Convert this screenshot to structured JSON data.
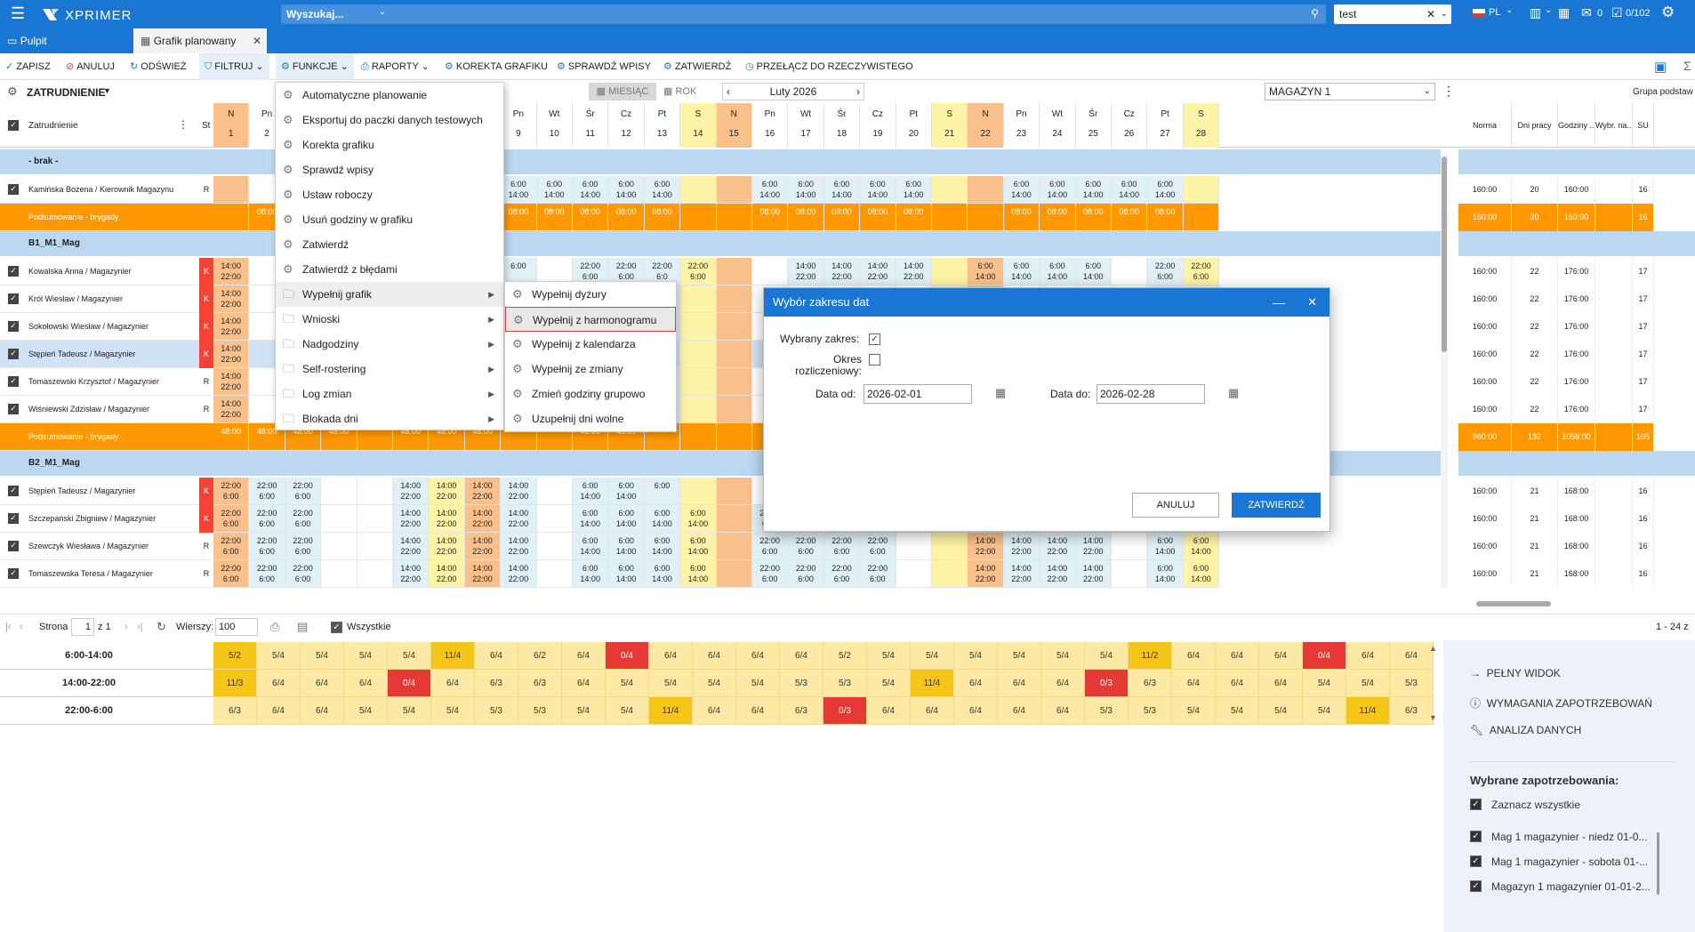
{
  "app": {
    "brand": "XPRIMER",
    "search_placeholder": "Wyszukaj...",
    "filter_value": "test",
    "lang": "PL",
    "counter_a": "0",
    "counter_b": "0/102"
  },
  "tabs": [
    {
      "label": "Pulpit"
    },
    {
      "label": "Grafik planowany"
    }
  ],
  "toolbar": {
    "save": "ZAPISZ",
    "cancel": "ANULUJ",
    "refresh": "ODŚWIEŻ",
    "filter": "FILTRUJ",
    "functions": "FUNKCJE",
    "reports": "RAPORTY",
    "correction": "KOREKTA GRAFIKU",
    "check": "SPRAWDŹ WPISY",
    "approve": "ZATWIERDŹ",
    "switch": "PRZEŁĄCZ DO RZECZYWISTEGO"
  },
  "subbar": {
    "group": "ZATRUDNIENIE",
    "month": "MIESIĄC",
    "year": "ROK",
    "period": "Luty 2026",
    "warehouse": "MAGAZYN 1",
    "group_label": "Grupa podstaw"
  },
  "grid": {
    "emp_header": "Zatrudnienie",
    "st_header": "St",
    "days": [
      {
        "d": "N",
        "n": "1"
      },
      {
        "d": "Pn",
        "n": "2"
      },
      {
        "d": "Wt",
        "n": "3"
      },
      {
        "d": "Śr",
        "n": "4"
      },
      {
        "d": "Cz",
        "n": "5"
      },
      {
        "d": "Pt",
        "n": "6"
      },
      {
        "d": "S",
        "n": "7"
      },
      {
        "d": "N",
        "n": "8"
      },
      {
        "d": "Pn",
        "n": "9"
      },
      {
        "d": "Wt",
        "n": "10"
      },
      {
        "d": "Śr",
        "n": "11"
      },
      {
        "d": "Cz",
        "n": "12"
      },
      {
        "d": "Pt",
        "n": "13"
      },
      {
        "d": "S",
        "n": "14"
      },
      {
        "d": "N",
        "n": "15"
      },
      {
        "d": "Pn",
        "n": "16"
      },
      {
        "d": "Wt",
        "n": "17"
      },
      {
        "d": "Śr",
        "n": "18"
      },
      {
        "d": "Cz",
        "n": "19"
      },
      {
        "d": "Pt",
        "n": "20"
      },
      {
        "d": "S",
        "n": "21"
      },
      {
        "d": "N",
        "n": "22"
      },
      {
        "d": "Pn",
        "n": "23"
      },
      {
        "d": "Wt",
        "n": "24"
      },
      {
        "d": "Śr",
        "n": "25"
      },
      {
        "d": "Cz",
        "n": "26"
      },
      {
        "d": "Pt",
        "n": "27"
      },
      {
        "d": "S",
        "n": "28"
      }
    ],
    "right_headers": [
      "Norma",
      "Dni pracy",
      "Godziny ...",
      "Wybr. na...",
      "SU"
    ],
    "rows": [
      {
        "kind": "group",
        "label": "- brak -"
      },
      {
        "kind": "emp",
        "name": "Kamińska Bożena / Kierownik Magazynu",
        "st": "R",
        "vals": [
          "",
          "",
          "",
          "",
          "",
          "",
          "",
          "",
          "6:00\n14:00",
          "6:00\n14:00",
          "6:00\n14:00",
          "6:00\n14:00",
          "6:00\n14:00",
          "",
          "",
          "6:00\n14:00",
          "6:00\n14:00",
          "6:00\n14:00",
          "6:00\n14:00",
          "6:00\n14:00",
          "",
          "",
          "6:00\n14:00",
          "6:00\n14:00",
          "6:00\n14:00",
          "6:00\n14:00",
          "6:00\n14:00",
          ""
        ],
        "right": [
          "160:00",
          "20",
          "160:00",
          "",
          "16"
        ]
      },
      {
        "kind": "sum",
        "name": "Podsumowanie - brygady",
        "vals": [
          "",
          "08:00",
          "",
          "",
          "",
          "",
          "",
          "",
          "08:00",
          "08:00",
          "08:00",
          "08:00",
          "08:00",
          "",
          "",
          "08:00",
          "08:00",
          "08:00",
          "08:00",
          "08:00",
          "",
          "",
          "08:00",
          "08:00",
          "08:00",
          "08:00",
          "08:00",
          ""
        ],
        "right": [
          "160:00",
          "20",
          "160:00",
          "",
          "16"
        ]
      },
      {
        "kind": "group",
        "label": "B1_M1_Mag"
      },
      {
        "kind": "emp",
        "name": "Kowalska Anna / Magazynier",
        "st": "K",
        "vals": [
          "14:00\n22:00",
          "",
          "",
          "",
          "",
          "",
          "",
          "6:00",
          "6:00",
          "",
          "22:00\n6:00",
          "22:00\n6:00",
          "22:00\n6:0",
          "22:00\n6:00",
          "",
          "",
          "14:00\n22:00",
          "14:00\n22:00",
          "14:00\n22:00",
          "14:00\n22:00",
          "",
          "6:00\n14:00",
          "6:00\n14:00",
          "6:00\n14:00",
          "6:00\n14:00",
          "",
          "22:00\n6:00",
          "22:00\n6:00"
        ],
        "right": [
          "160:00",
          "22",
          "176:00",
          "",
          "17"
        ]
      },
      {
        "kind": "emp",
        "name": "Król Wiesław / Magazynier",
        "st": "K",
        "vals": [
          "14:00\n22:00",
          "",
          "",
          "",
          "",
          "",
          "",
          "",
          "",
          "",
          "",
          "22:00\n6:00",
          "22:\n6:0",
          "",
          "",
          "",
          "",
          "",
          "",
          "",
          "",
          "",
          "",
          "",
          "",
          "",
          "22:00\n6:00",
          "22:00\n6:00"
        ],
        "right": [
          "160:00",
          "22",
          "176:00",
          "",
          "17"
        ]
      },
      {
        "kind": "emp",
        "name": "Sokołowski Wiesław / Magazynier",
        "st": "K",
        "vals": [
          "14:00\n22:00",
          "",
          "",
          "",
          "",
          "",
          "",
          "",
          "",
          "",
          "",
          "22:00\n6:00",
          "22:\n6:0",
          "",
          "",
          "",
          "",
          "",
          "",
          "",
          "",
          "",
          "",
          "",
          "",
          "",
          "22:00\n6:00",
          "22:00\n6:00"
        ],
        "right": [
          "160:00",
          "22",
          "176:00",
          "",
          "17"
        ]
      },
      {
        "kind": "emp",
        "name": "Stępień Tadeusz / Magazynier",
        "st": "K",
        "sel": true,
        "vals": [
          "14:00\n22:00",
          "",
          "",
          "",
          "",
          "",
          "",
          "",
          "",
          "",
          "",
          "22:00\n6:00",
          "22:\n6:0",
          "",
          "",
          "",
          "",
          "",
          "",
          "",
          "",
          "",
          "",
          "",
          "",
          "",
          "22:00\n6:00",
          "22:00\n6:00"
        ],
        "right": [
          "160:00",
          "22",
          "176:00",
          "",
          "17"
        ]
      },
      {
        "kind": "emp",
        "name": "Tomaszewski Krzysztof / Magazynier",
        "st": "R",
        "vals": [
          "14:00\n22:00",
          "",
          "",
          "",
          "",
          "",
          "",
          "",
          "",
          "",
          "",
          "22:00\n6:00",
          "22:\n6:0",
          "",
          "",
          "",
          "",
          "",
          "",
          "",
          "",
          "",
          "",
          "",
          "",
          "",
          "22:00\n6:00",
          "22:00\n6:00"
        ],
        "right": [
          "160:00",
          "22",
          "176:00",
          "",
          "17"
        ]
      },
      {
        "kind": "emp",
        "name": "Wiśniewski Zdzisław / Magazynier",
        "st": "R",
        "vals": [
          "14:00\n22:00",
          "",
          "",
          "",
          "",
          "",
          "",
          "",
          "",
          "",
          "",
          "22:00\n6:00",
          "22:\n6:0",
          "",
          "",
          "",
          "",
          "",
          "",
          "",
          "",
          "",
          "",
          "",
          "",
          "",
          "22:00\n6:00",
          "22:00\n6:00"
        ],
        "right": [
          "160:00",
          "22",
          "176:00",
          "",
          "17"
        ]
      },
      {
        "kind": "sum",
        "name": "Podsumowanie - brygady",
        "vals": [
          "48:00",
          "48:00",
          "48:00",
          "48:00",
          "",
          "48:00",
          "48:00",
          "48:00",
          "",
          "",
          "48:00",
          "48:00",
          "",
          "",
          "",
          "",
          "",
          "",
          "",
          "",
          "",
          "",
          "",
          "",
          "",
          "",
          "48:00",
          "48:00"
        ],
        "right": [
          "960:00",
          "132",
          "1056:00",
          "",
          "105"
        ]
      },
      {
        "kind": "group",
        "label": "B2_M1_Mag"
      },
      {
        "kind": "emp",
        "name": "Stępień Tadeusz / Magazynier",
        "st": "K",
        "vals": [
          "22:00\n6:00",
          "22:00\n6:00",
          "22:00\n6:00",
          "",
          "",
          "14:00\n22:00",
          "14:00\n22:00",
          "14:00\n22:00",
          "14:00\n22:00",
          "",
          "6:00\n14:00",
          "6:00\n14:00",
          "6:00\n",
          "",
          "",
          "",
          "",
          "",
          "",
          "",
          "",
          "",
          "",
          "",
          "",
          "",
          "6:00\n14:00",
          "6:00\n14:00"
        ],
        "right": [
          "160:00",
          "21",
          "168:00",
          "",
          "16"
        ]
      },
      {
        "kind": "emp",
        "name": "Szczepański Zbigniew / Magazynier",
        "st": "K",
        "vals": [
          "22:00\n6:00",
          "22:00\n6:00",
          "22:00\n6:00",
          "",
          "",
          "14:00\n22:00",
          "14:00\n22:00",
          "14:00\n22:00",
          "14:00\n22:00",
          "",
          "6:00\n14:00",
          "6:00\n14:00",
          "6:00\n14:00",
          "6:00\n14:00",
          "",
          "22:00\n6:00",
          "22:00\n6:00",
          "22:00\n6:00",
          "22:00\n6:00",
          "",
          "",
          "14:00\n22:00",
          "14:00\n22:00",
          "14:00\n22:00",
          "14:00\n22:00",
          "",
          "6:00\n14:00",
          "6:00\n14:00"
        ],
        "right": [
          "160:00",
          "21",
          "168:00",
          "",
          "16"
        ]
      },
      {
        "kind": "emp",
        "name": "Szewczyk Wiesława / Magazynier",
        "st": "R",
        "vals": [
          "22:00\n6:00",
          "22:00\n6:00",
          "22:00\n6:00",
          "",
          "",
          "14:00\n22:00",
          "14:00\n22:00",
          "14:00\n22:00",
          "14:00\n22:00",
          "",
          "6:00\n14:00",
          "6:00\n14:00",
          "6:00\n14:00",
          "6:00\n14:00",
          "",
          "22:00\n6:00",
          "22:00\n6:00",
          "22:00\n6:00",
          "22:00\n6:00",
          "",
          "",
          "14:00\n22:00",
          "14:00\n22:00",
          "14:00\n22:00",
          "14:00\n22:00",
          "",
          "6:00\n14:00",
          "6:00\n14:00"
        ],
        "right": [
          "160:00",
          "21",
          "168:00",
          "",
          "16"
        ]
      },
      {
        "kind": "emp",
        "name": "Tomaszewska Teresa / Magazynier",
        "st": "R",
        "vals": [
          "22:00\n6:00",
          "22:00\n6:00",
          "22:00\n6:00",
          "",
          "",
          "14:00\n22:00",
          "14:00\n22:00",
          "14:00\n22:00",
          "14:00\n22:00",
          "",
          "6:00\n14:00",
          "6:00\n14:00",
          "6:00\n14:00",
          "6:00\n14:00",
          "",
          "22:00\n6:00",
          "22:00\n6:00",
          "22:00\n6:00",
          "22:00\n6:00",
          "",
          "",
          "14:00\n22:00",
          "14:00\n22:00",
          "14:00\n22:00",
          "14:00\n22:00",
          "",
          "6:00\n14:00",
          "6:00\n14:00"
        ],
        "right": [
          "160:00",
          "21",
          "168:00",
          "",
          "16"
        ]
      }
    ]
  },
  "pager": {
    "page_label": "Strona",
    "page": "1",
    "of": "z 1",
    "rows_label": "Wierszy:",
    "rows": "100",
    "all_label": "Wszystkie",
    "range": "1 - 24 z"
  },
  "demand": {
    "rows": [
      {
        "label": "6:00-14:00",
        "vals": [
          "5/2",
          "5/4",
          "5/4",
          "5/4",
          "5/4",
          "11/4",
          "6/4",
          "6/2",
          "6/4",
          "0/4",
          "6/4",
          "6/4",
          "6/4",
          "6/4",
          "5/2",
          "5/4",
          "5/4",
          "5/4",
          "5/4",
          "5/4",
          "5/4",
          "11/2",
          "6/4",
          "6/4",
          "6/4",
          "0/4",
          "6/4",
          "6/4"
        ]
      },
      {
        "label": "14:00-22:00",
        "vals": [
          "11/3",
          "6/4",
          "6/4",
          "6/4",
          "0/4",
          "6/4",
          "6/3",
          "6/3",
          "6/4",
          "5/4",
          "5/4",
          "5/4",
          "5/4",
          "5/3",
          "5/3",
          "5/4",
          "11/4",
          "6/4",
          "6/4",
          "6/4",
          "0/3",
          "6/3",
          "6/4",
          "6/4",
          "6/4",
          "5/4",
          "5/4",
          "5/3"
        ]
      },
      {
        "label": "22:00-6:00",
        "vals": [
          "6/3",
          "6/4",
          "6/4",
          "5/4",
          "5/4",
          "5/4",
          "5/3",
          "5/3",
          "5/4",
          "5/4",
          "11/4",
          "6/4",
          "6/4",
          "6/3",
          "0/3",
          "6/4",
          "6/4",
          "6/4",
          "6/4",
          "6/4",
          "5/3",
          "5/3",
          "5/4",
          "5/4",
          "5/4",
          "5/4",
          "11/4",
          "6/3"
        ]
      }
    ]
  },
  "colors": {
    "brand": "#1976d2",
    "sunday": "#f9c08c",
    "saturday": "#fdf3a6",
    "weekday_light": "#dff1f7",
    "summary": "#ff9800",
    "group": "#bcd7f0",
    "k_red": "#f44336",
    "demand_ok": "#fde9a4",
    "demand_mid": "#f5c518",
    "demand_bad": "#e53935"
  },
  "functions_menu": [
    {
      "label": "Automatyczne planowanie"
    },
    {
      "label": "Eksportuj do paczki danych testowych"
    },
    {
      "label": "Korekta grafiku"
    },
    {
      "label": "Sprawdź wpisy"
    },
    {
      "label": "Ustaw roboczy"
    },
    {
      "label": "Usuń godziny w grafiku"
    },
    {
      "label": "Zatwierdź"
    },
    {
      "label": "Zatwierdź z błędami"
    },
    {
      "label": "Wypełnij grafik",
      "sub": true,
      "folder": true
    },
    {
      "label": "Wnioski",
      "sub": true,
      "folder": true
    },
    {
      "label": "Nadgodziny",
      "sub": true,
      "folder": true
    },
    {
      "label": "Self-rostering",
      "sub": true,
      "folder": true
    },
    {
      "label": "Log zmian",
      "sub": true,
      "folder": true
    },
    {
      "label": "Blokada dni",
      "sub": true,
      "folder": true
    }
  ],
  "fill_submenu": [
    {
      "label": "Wypełnij dyżury"
    },
    {
      "label": "Wypełnij z harmonogramu"
    },
    {
      "label": "Wypełnij z kalendarza"
    },
    {
      "label": "Wypełnij ze zmiany"
    },
    {
      "label": "Zmień godziny grupowo"
    },
    {
      "label": "Uzupełnij dni wolne"
    }
  ],
  "dialog": {
    "title": "Wybór zakresu dat",
    "selected_range": "Wybrany zakres:",
    "period_l1": "Okres",
    "period_l2": "rozliczeniowy:",
    "date_from_label": "Data od:",
    "date_from": "2026-02-01",
    "date_to_label": "Data do:",
    "date_to": "2026-02-28",
    "cancel": "ANULUJ",
    "confirm": "ZATWIERDŹ"
  },
  "side": {
    "full_view": "PEŁNY WIDOK",
    "requirements": "WYMAGANIA ZAPOTRZEBOWAŃ",
    "analysis": "ANALIZA DANYCH",
    "selected_title": "Wybrane zapotrzebowania:",
    "select_all": "Zaznacz wszystkie",
    "items": [
      "Mag 1 magazynier - niedz 01-0...",
      "Mag 1 magazynier - sobota 01-...",
      "Magazyn 1 magazynier 01-01-2..."
    ]
  }
}
